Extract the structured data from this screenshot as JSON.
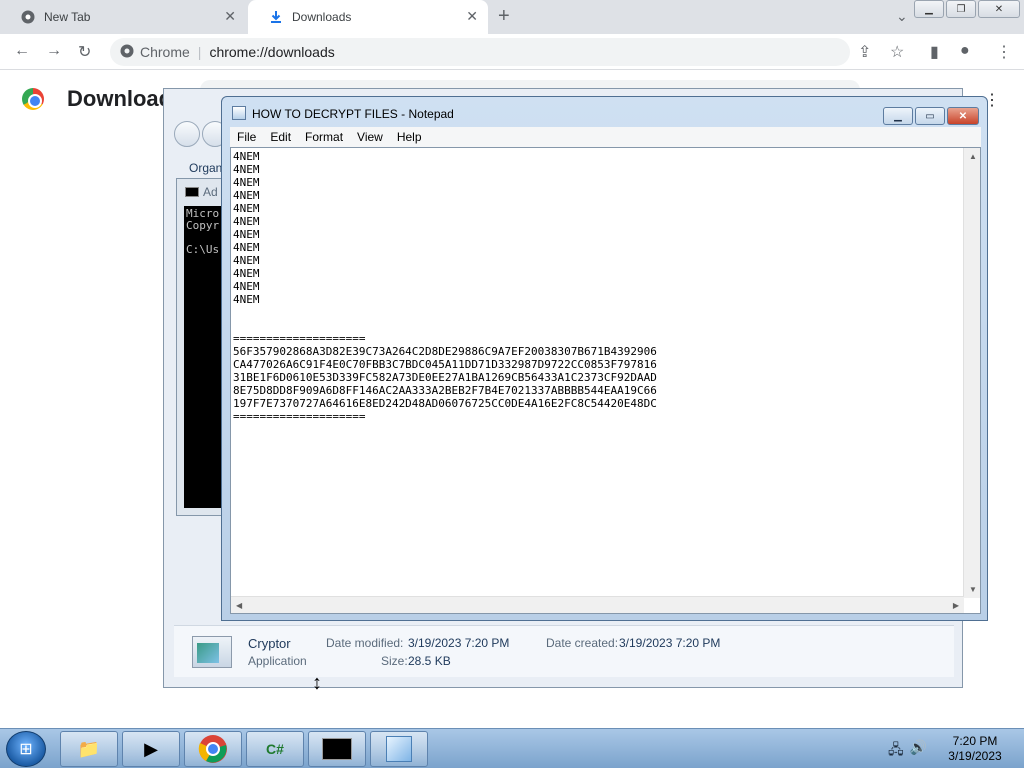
{
  "browser": {
    "tabs": [
      {
        "label": "New Tab"
      },
      {
        "label": "Downloads"
      }
    ],
    "omnibox": {
      "site": "Chrome",
      "separator": "|",
      "url": "chrome://downloads"
    }
  },
  "downloads_page": {
    "title": "Downloads"
  },
  "explorer": {
    "organize_label": "Organ",
    "details": {
      "name": "Cryptor",
      "type": "Application",
      "date_modified_label": "Date modified:",
      "date_modified": "3/19/2023 7:20 PM",
      "date_created_label": "Date created:",
      "date_created": "3/19/2023 7:20 PM",
      "size_label": "Size:",
      "size": "28.5 KB"
    }
  },
  "cmd": {
    "title": "Ad",
    "lines": "Micro\nCopyr\n\nC:\\Us"
  },
  "notepad": {
    "title": "HOW TO DECRYPT FILES - Notepad",
    "menu": [
      "File",
      "Edit",
      "Format",
      "View",
      "Help"
    ],
    "content": "4NEM\n4NEM\n4NEM\n4NEM\n4NEM\n4NEM\n4NEM\n4NEM\n4NEM\n4NEM\n4NEM\n4NEM\n\n\n====================\n56F357902868A3D82E39C73A264C2D8DE29886C9A7EF20038307B671B4392906\nCA477026A6C91F4E0C70FBB3C7BDC045A11DD71D332987D9722CC0853F797816\n31BE1F6D0610E53D339FC582A73DE0EE27A1BA1269CB56433A1C2373CF92DAAD\n8E75D8DD8F909A6D8FF146AC2AA333A2BEB2F7B4E7021337ABBBB544EAA19C66\n197F7E7370727A64616E8ED242D48AD06076725CC0DE4A16E2FC8C54420E48DC\n===================="
  },
  "taskbar": {
    "clock_time": "7:20 PM",
    "clock_date": "3/19/2023",
    "items": [
      "file-explorer",
      "media-player",
      "chrome",
      "csharp-app",
      "command-prompt",
      "notepad"
    ]
  }
}
